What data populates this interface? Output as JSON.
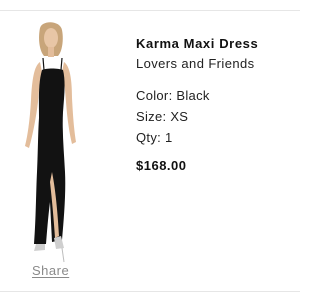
{
  "product": {
    "title": "Karma Maxi Dress",
    "brand": "Lovers and Friends",
    "color": "Color: Black",
    "size": "Size: XS",
    "qty": "Qty: 1",
    "price": "$168.00",
    "image_icon": "model-in-black-maxi-dress"
  },
  "actions": {
    "share_label": "Share"
  }
}
